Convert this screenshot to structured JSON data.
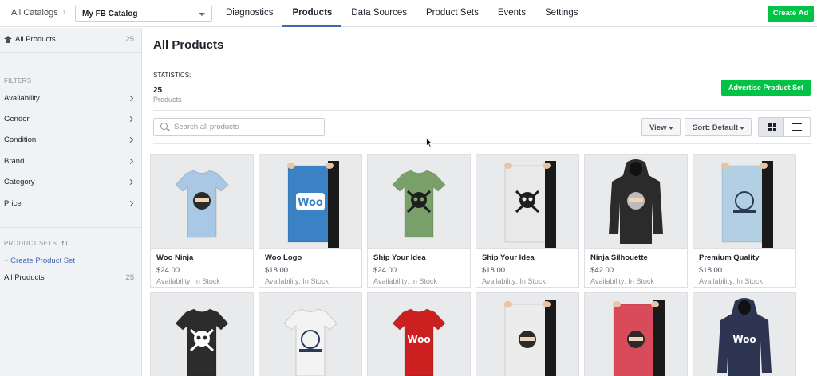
{
  "topbar": {
    "catalogs_label": "All Catalogs",
    "catalog_selected": "My FB Catalog",
    "tabs": [
      "Diagnostics",
      "Products",
      "Data Sources",
      "Product Sets",
      "Events",
      "Settings"
    ],
    "active_tab": "Products",
    "create_ad_label": "Create Ad"
  },
  "sidebar": {
    "all_products_label": "All Products",
    "all_products_count": "25",
    "filters_heading": "FILTERS",
    "filters": [
      "Availability",
      "Gender",
      "Condition",
      "Brand",
      "Category",
      "Price"
    ],
    "product_sets_heading": "PRODUCT SETS",
    "sort_glyph": "↑↓",
    "create_set_label": "+ Create Product Set",
    "sets": [
      {
        "label": "All Products",
        "count": "25"
      }
    ]
  },
  "main": {
    "title": "All Products",
    "stats_label": "STATISTICS:",
    "stats_count": "25",
    "stats_unit": "Products",
    "advertise_label": "Advertise Product Set",
    "search_placeholder": "Search all products",
    "view_label": "View",
    "sort_label": "Sort: Default"
  },
  "products": [
    {
      "name": "Woo Ninja",
      "price": "$24.00",
      "availability": "Availability: In Stock",
      "kind": "tshirt",
      "color": "#a9c8e6",
      "graphic": "ninja"
    },
    {
      "name": "Woo Logo",
      "price": "$18.00",
      "availability": "Availability: In Stock",
      "kind": "poster",
      "color": "#3a82c4",
      "graphic": "woo"
    },
    {
      "name": "Ship Your Idea",
      "price": "$24.00",
      "availability": "Availability: In Stock",
      "kind": "tshirt",
      "color": "#7aa06a",
      "graphic": "skull"
    },
    {
      "name": "Ship Your Idea",
      "price": "$18.00",
      "availability": "Availability: In Stock",
      "kind": "poster",
      "color": "#e9e9e9",
      "graphic": "skull"
    },
    {
      "name": "Ninja Silhouette",
      "price": "$42.00",
      "availability": "Availability: In Stock",
      "kind": "hoodie",
      "color": "#2b2b2b",
      "graphic": "ninja-light"
    },
    {
      "name": "Premium Quality",
      "price": "$18.00",
      "availability": "Availability: In Stock",
      "kind": "poster",
      "color": "#b3cfe4",
      "graphic": "badge"
    }
  ],
  "products_row2": [
    {
      "kind": "tshirt",
      "color": "#2c2c2c",
      "graphic": "skull-light"
    },
    {
      "kind": "tshirt",
      "color": "#f3f3f3",
      "graphic": "badge"
    },
    {
      "kind": "tshirt",
      "color": "#cc1f1f",
      "graphic": "woo-text"
    },
    {
      "kind": "poster",
      "color": "#ececec",
      "graphic": "ninja"
    },
    {
      "kind": "poster",
      "color": "#d94a5a",
      "graphic": "ninja"
    },
    {
      "kind": "hoodie",
      "color": "#2d3552",
      "graphic": "woo-text"
    }
  ]
}
